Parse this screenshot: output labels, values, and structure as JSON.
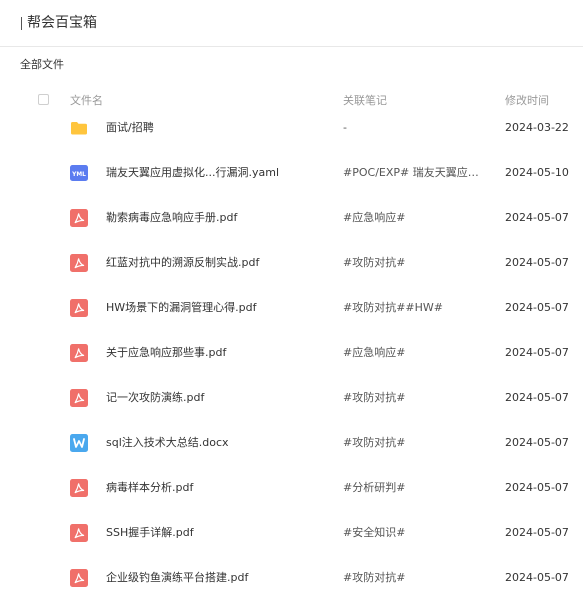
{
  "header": {
    "title": "帮会百宝箱"
  },
  "breadcrumb": "全部文件",
  "columns": {
    "name": "文件名",
    "note": "关联笔记",
    "modified": "修改时间"
  },
  "colors": {
    "pdf": "#f0706a",
    "yaml": "#5b7cf0",
    "word": "#4aa8ee",
    "folder": "#ffc53d"
  },
  "files": [
    {
      "icon": "folder-icon",
      "name": "面试/招聘",
      "note": "-",
      "date": "2024-03-22"
    },
    {
      "icon": "yaml-file-icon",
      "name": "瑞友天翼应用虚拟化...行漏洞.yaml",
      "note": "#POC/EXP# 瑞友天翼应用...",
      "date": "2024-05-10"
    },
    {
      "icon": "pdf-file-icon",
      "name": "勒索病毒应急响应手册.pdf",
      "note": "#应急响应#",
      "date": "2024-05-07"
    },
    {
      "icon": "pdf-file-icon",
      "name": "红蓝对抗中的溯源反制实战.pdf",
      "note": "#攻防对抗#",
      "date": "2024-05-07"
    },
    {
      "icon": "pdf-file-icon",
      "name": "HW场景下的漏洞管理心得.pdf",
      "note": "#攻防对抗##HW#",
      "date": "2024-05-07"
    },
    {
      "icon": "pdf-file-icon",
      "name": "关于应急响应那些事.pdf",
      "note": "#应急响应#",
      "date": "2024-05-07"
    },
    {
      "icon": "pdf-file-icon",
      "name": "记一次攻防演练.pdf",
      "note": "#攻防对抗#",
      "date": "2024-05-07"
    },
    {
      "icon": "word-file-icon",
      "name": "sql注入技术大总结.docx",
      "note": "#攻防对抗#",
      "date": "2024-05-07"
    },
    {
      "icon": "pdf-file-icon",
      "name": "病毒样本分析.pdf",
      "note": "#分析研判#",
      "date": "2024-05-07"
    },
    {
      "icon": "pdf-file-icon",
      "name": "SSH握手详解.pdf",
      "note": "#安全知识#",
      "date": "2024-05-07"
    },
    {
      "icon": "pdf-file-icon",
      "name": "企业级钓鱼演练平台搭建.pdf",
      "note": "#攻防对抗#",
      "date": "2024-05-07"
    }
  ]
}
